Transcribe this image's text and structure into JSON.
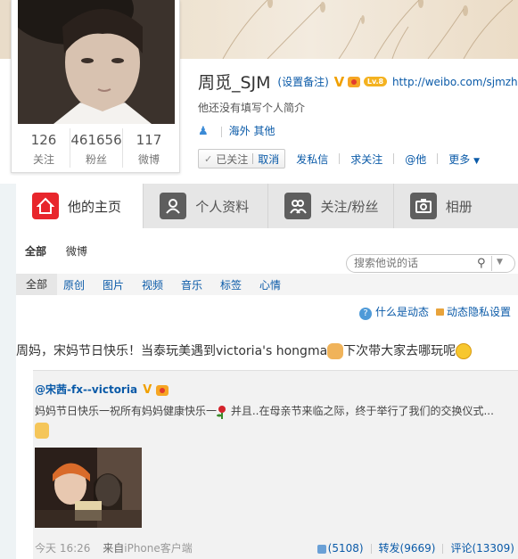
{
  "profile": {
    "name": "周觅_SJM",
    "remark_label": "(设置备注)",
    "verified_badge": "V",
    "level_badge": "Lv.8",
    "url": "http://weibo.com/sjmzhou",
    "bio": "他还没有填写个人简介",
    "location": "海外 其他",
    "stats": [
      {
        "num": "126",
        "label": "关注"
      },
      {
        "num": "461656",
        "label": "粉丝"
      },
      {
        "num": "117",
        "label": "微博"
      }
    ]
  },
  "actions": {
    "followed": "已关注",
    "cancel": "取消",
    "message": "发私信",
    "ask_follow": "求关注",
    "at_him": "@他",
    "more": "更多"
  },
  "tabs": [
    {
      "label": "他的主页",
      "icon": "home-icon"
    },
    {
      "label": "个人资料",
      "icon": "profile-icon"
    },
    {
      "label": "关注/粉丝",
      "icon": "followers-icon"
    },
    {
      "label": "相册",
      "icon": "camera-icon"
    }
  ],
  "subtabs": [
    "全部",
    "微博"
  ],
  "search": {
    "placeholder": "搜索他说的话"
  },
  "filters": [
    "全部",
    "原创",
    "图片",
    "视频",
    "音乐",
    "标签",
    "心情"
  ],
  "help": {
    "what": "什么是动态",
    "privacy": "动态隐私设置"
  },
  "post": {
    "text_before": "周妈，宋妈节日快乐！当泰玩美遇到victoria's hongma",
    "text_after": "下次带大家去哪玩呢"
  },
  "repost": {
    "author": "@宋茜-fx--victoria",
    "text_before": "妈妈节日快乐一祝所有妈妈健康快乐一",
    "text_after": "并且..在母亲节来临之际，终于举行了我们的交换仪式...",
    "time": "今天 16:26",
    "source_prefix": "来自",
    "source": "iPhone客户端",
    "likes": "(5108)",
    "reposts": "转发(9669)",
    "comments": "评论(13309)"
  }
}
